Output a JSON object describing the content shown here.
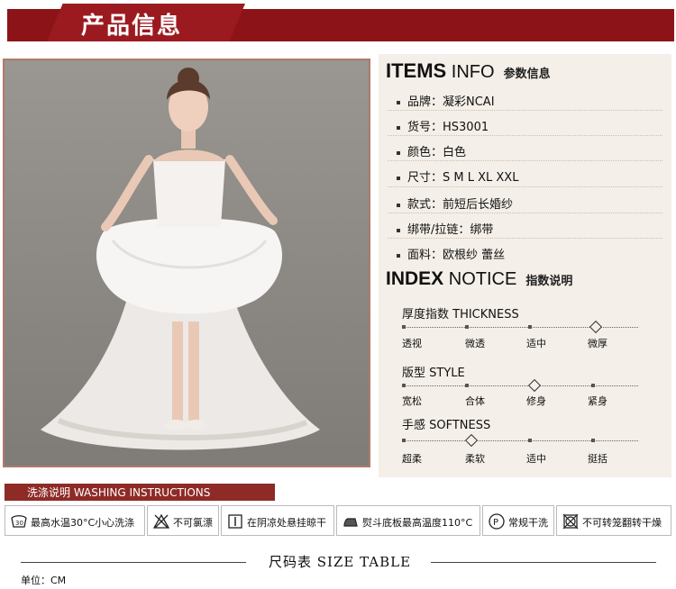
{
  "header": {
    "title": "产品信息"
  },
  "items": {
    "heading_bold": "ITEMS",
    "heading_thin": " INFO",
    "heading_cn": "参数信息",
    "rows": [
      "品牌：凝彩NCAI",
      "货号：HS3001",
      "颜色：白色",
      "尺寸：S  M  L  XL  XXL",
      "款式：前短后长婚纱",
      "绑带/拉链：绑带",
      "面料：欧根纱  蕾丝"
    ]
  },
  "index": {
    "heading_bold": "INDEX",
    "heading_thin": " NOTICE",
    "heading_cn": "指数说明",
    "scales": [
      {
        "title": "厚度指数 THICKNESS",
        "labels": [
          "透视",
          "微透",
          "适中",
          "微厚"
        ],
        "selected": 3
      },
      {
        "title": "版型 STYLE",
        "labels": [
          "宽松",
          "合体",
          "修身",
          "紧身"
        ],
        "selected": 2
      },
      {
        "title": "手感 SOFTNESS",
        "labels": [
          "超柔",
          "柔软",
          "适中",
          "挺括"
        ],
        "selected": 1
      }
    ]
  },
  "washing": {
    "title": "洗涤说明  WASHING INSTRUCTIONS",
    "items": [
      {
        "icon": "wash-30-icon",
        "text": "最高水温30°C小心洗涤"
      },
      {
        "icon": "no-bleach-icon",
        "text": "不可氯漂"
      },
      {
        "icon": "line-dry-shade-icon",
        "text": "在阴凉处悬挂晾干"
      },
      {
        "icon": "iron-icon",
        "text": "熨斗底板最高温度110°C"
      },
      {
        "icon": "dry-clean-icon",
        "text": "常规干洗"
      },
      {
        "icon": "no-tumble-dry-icon",
        "text": "不可转笼翻转干燥"
      }
    ],
    "icon_badge_30": "30",
    "icon_badge_p": "P"
  },
  "size_table": {
    "title": "尺码表 SIZE TABLE",
    "unit": "单位：CM"
  },
  "colors": {
    "brand": "#8c1418",
    "panel": "#f4efe8",
    "wash_bar": "#8e2b27"
  }
}
